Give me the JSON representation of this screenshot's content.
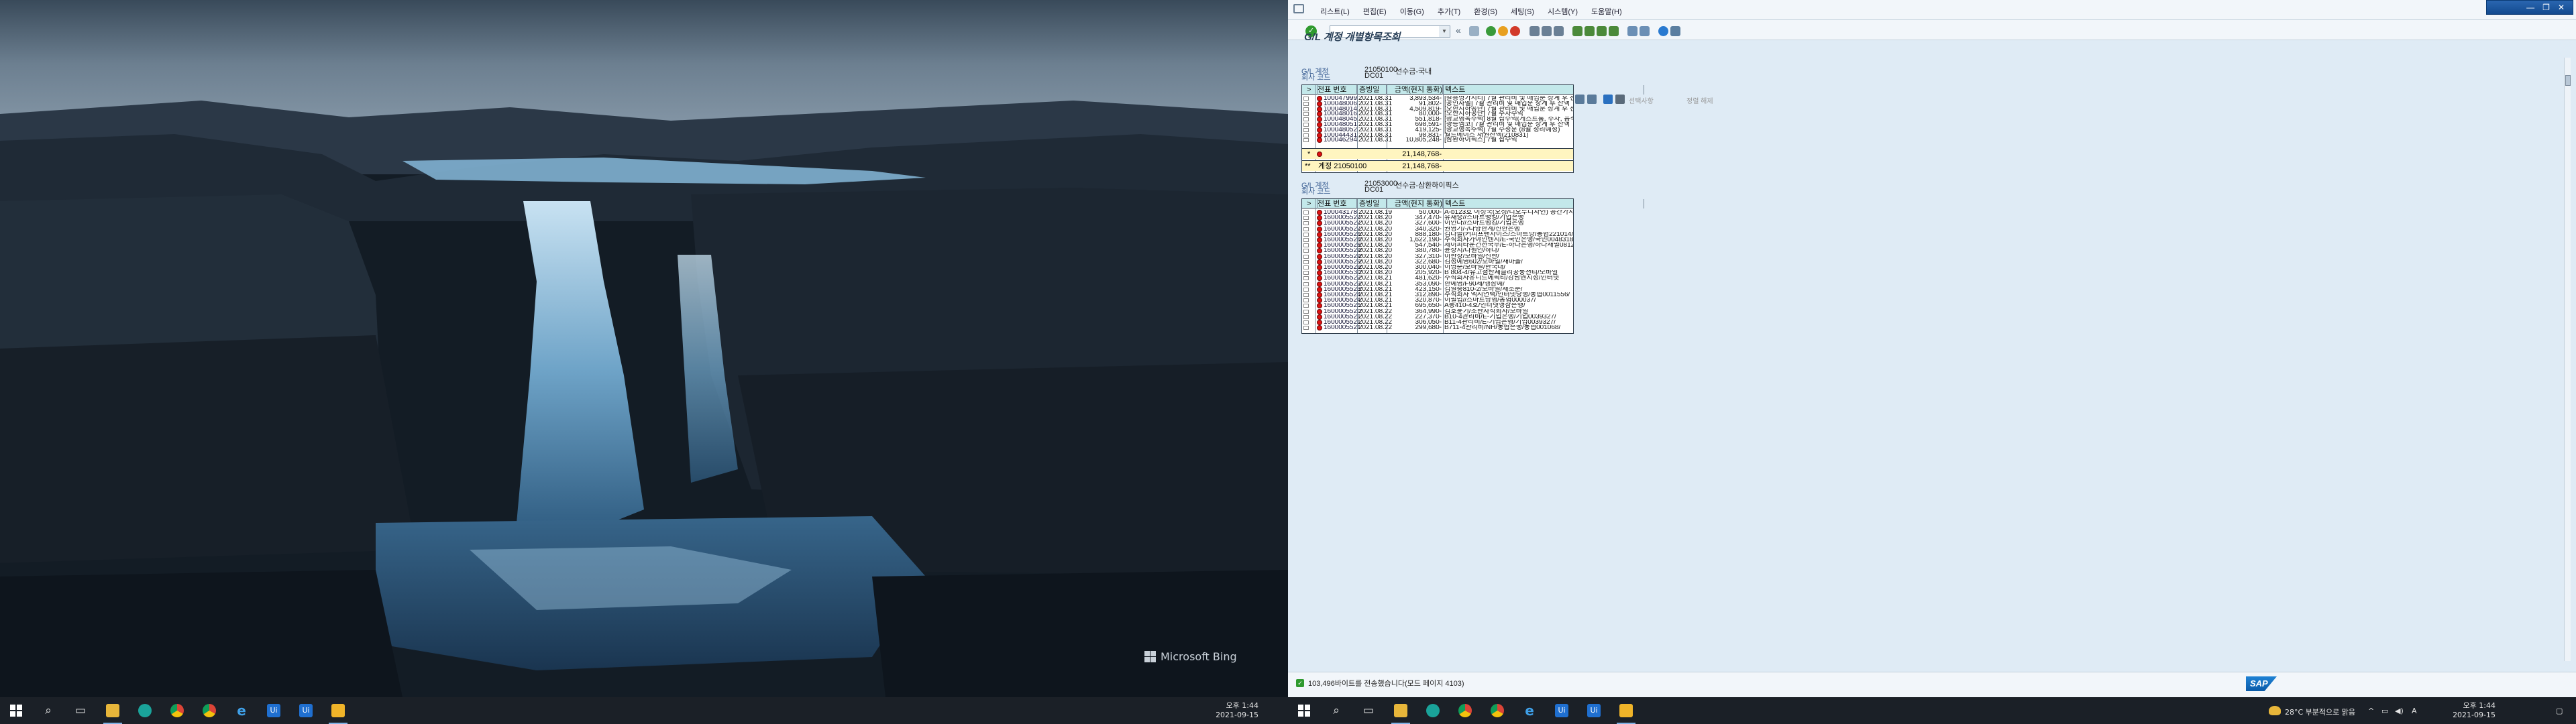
{
  "left_screen": {
    "wallpaper_credit": "Microsoft Bing",
    "clock_time": "오후 1:44",
    "clock_date": "2021-09-15"
  },
  "taskbar_icons": [
    "windows-icon",
    "search-icon",
    "task-view-icon",
    "file-explorer-icon",
    "edge-icon",
    "chrome-icon",
    "chrome-icon",
    "internet-explorer-icon",
    "uipath-studio-icon",
    "uipath-robot-icon",
    "sap-logon-icon"
  ],
  "sap": {
    "menu": [
      "리스트(L)",
      "편집(E)",
      "이동(G)",
      "추가(T)",
      "환경(S)",
      "세팅(S)",
      "시스템(Y)",
      "도움말(H)"
    ],
    "title": "G/L 계정 개별항목조회",
    "toolbar2_disabled": [
      "선택사항",
      "정렬 해제"
    ],
    "accounts": [
      {
        "gl_label": "G/L 계정",
        "gl_number": "21050100",
        "gl_name": "선수금-국내",
        "company_label": "회사 코드",
        "company_code": "DC01",
        "columns": [
          ">",
          "전표 번호",
          "증빙일",
          "금액(현지 통화)",
          "텍스트"
        ],
        "rows": [
          [
            "100047999",
            "2021.08.31",
            "3,893,534-",
            "[갈흥명가시티] 7월 관리비 및 매입분 상계 후 잔액"
          ],
          [
            "100048006",
            "2021.08.31",
            "91,802-",
            "[공인자벨] 7월 관리비 및 매입분 상계 후 잔액"
          ],
          [
            "100048014",
            "2021.08.31",
            "4,509,819-",
            "[오한지하공단] 7월 관리비 및 매입분 상계 후 잔액"
          ],
          [
            "100048016",
            "2021.08.31",
            "80,000-",
            "[오한지하공단] 7월 주차수익"
          ],
          [
            "100048045",
            "2021.08.31",
            "551,818-",
            "[광교행복주택] 8월 잡수익(게스트룸, 주차, 음식물>"
          ],
          [
            "100048051",
            "2021.08.31",
            "698,591-",
            "[광릉엠코] 7월 관리비 및 매입분 상계 후 잔액"
          ],
          [
            "100048052",
            "2021.08.31",
            "419,125-",
            "[광교행복주택] 7월 수정분 (8월 정리예정)"
          ],
          [
            "100044431",
            "2021.08.31",
            "98,831-",
            "월드메이스 채권잔액(210831)"
          ],
          [
            "100046294",
            "2021.08.31",
            "10,805,248-",
            "[삼환하이픽스] 7월 잡수익"
          ]
        ],
        "subtotal_marker": "*",
        "subtotal": "21,148,768-",
        "total_marker": "**",
        "total_label": "계정 21050100",
        "total": "21,148,768-"
      },
      {
        "gl_label": "G/L 계정",
        "gl_number": "21053000",
        "gl_name": "선수금-삼환하이픽스",
        "company_label": "회사 코드",
        "company_code": "DC01",
        "columns": [
          ">",
          "전표 번호",
          "증빙일",
          "금액(현지 통화)",
          "텍스트"
        ],
        "rows": [
          [
            "100043178",
            "2021.08.19",
            "50,000-",
            "A-b123호 이성국(오성/디오투디자인) 공간가사용료"
          ],
          [
            "1600005527",
            "2021.08.20",
            "347,470-",
            "유재승//스마트뱅킹/기업은행"
          ],
          [
            "1600005527",
            "2021.08.20",
            "327,600-",
            "이인나//스마트뱅킹/기업은행"
          ],
          [
            "1600005527",
            "2021.08.20",
            "340,320-",
            "권영기/-/다양한계/신한은행"
          ],
          [
            "1600005526",
            "2021.08.20",
            "888,180-",
            "김다솔(커피프랜차이즈/스마트당/농협221014/"
          ],
          [
            "1600005528",
            "2021.08.20",
            "1,622,190-",
            "주식회사가야인텐지/E-국민은행/국민0048318/"
          ],
          [
            "1600005528",
            "2021.08.20",
            "547,540-",
            "제이피타운건전국무/E-하나은행/하나새별0812256/"
          ],
          [
            "1600005529",
            "2021.08.20",
            "380,780-",
            "윤상지/다원인/하나/"
          ],
          [
            "1600005529",
            "2021.08.20",
            "327,310-",
            "이한상/모바일/신한/"
          ],
          [
            "1600005529",
            "2021.08.20",
            "322,680-",
            "김정예영602/모바일/새마을/"
          ],
          [
            "1600005529",
            "2021.08.20",
            "300,040-",
            "이명순/모바일/한국대/"
          ],
          [
            "1600005530",
            "2021.08.20",
            "205,920-",
            "B 804-4/유고첨한체클리공동전티/모바일"
          ],
          [
            "1600005522",
            "2021.08.21",
            "481,620-",
            "주식회사유니드에픽티/강남엔지정/인터넷"
          ],
          [
            "1600005523",
            "2021.08.21",
            "353,090-",
            "한예영/F90제/앵삼예/"
          ],
          [
            "1600005523",
            "2021.08.21",
            "423,150-",
            "김일중810-2/모바일/새소문/"
          ],
          [
            "1600005524",
            "2021.08.21",
            "312,890-",
            "주식회사 엑시언택/인터넷당행/농협0011556/"
          ],
          [
            "1600005524",
            "2021.08.21",
            "320,870-",
            "이필업//스마트당행/농협000037/"
          ],
          [
            "1600005525",
            "2021.08.21",
            "695,650-",
            "A동410-4호/인터넷앵삼은행/"
          ],
          [
            "1600005520",
            "2021.08.22",
            "364,990-",
            "김호윤기/조한자식회사/모바일"
          ],
          [
            "1600005521",
            "2021.08.22",
            "227,370-",
            "B10-4관리비/E-기업은행/기업0039327/"
          ],
          [
            "1600005521",
            "2021.08.22",
            "306,050-",
            "B11-4관리비/E-기업은행/기업0039327/"
          ],
          [
            "1600005521",
            "2021.08.22",
            "299,680-",
            "B711-4관리비/NH/농협은행/농협001068/"
          ]
        ]
      }
    ],
    "status_message": "103,496바이트를 전송했습니다(모드 페이지 4103)",
    "tray_weather": "28°C 부분적으로 맑음",
    "tray_lang": "A",
    "clock_time": "오후 1:44",
    "clock_date": "2021-09-15"
  }
}
